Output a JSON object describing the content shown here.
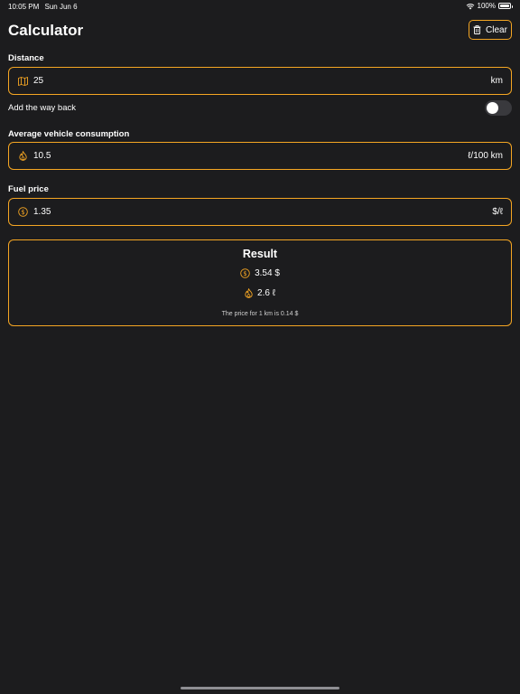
{
  "status": {
    "time": "10:05 PM",
    "date": "Sun Jun 6",
    "battery": "100%"
  },
  "header": {
    "title": "Calculator",
    "clear_label": "Clear"
  },
  "distance": {
    "label": "Distance",
    "value": "25",
    "unit": "km",
    "icon": "map-icon"
  },
  "way_back": {
    "label": "Add the way back",
    "enabled": false
  },
  "consumption": {
    "label": "Average vehicle consumption",
    "value": "10.5",
    "unit": "ℓ/100 km",
    "icon": "flame-icon"
  },
  "fuel_price": {
    "label": "Fuel price",
    "value": "1.35",
    "unit": "$/ℓ",
    "icon": "dollar-coin-icon"
  },
  "result": {
    "title": "Result",
    "cost": "3.54 $",
    "fuel": "2.6 ℓ",
    "note": "The price for 1 km is 0.14 $"
  },
  "colors": {
    "accent": "#f5a623",
    "background": "#1c1c1e"
  }
}
